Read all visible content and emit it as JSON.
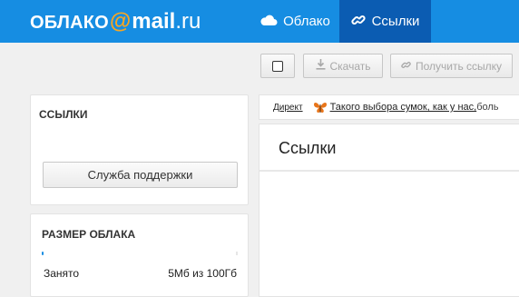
{
  "header": {
    "logo": {
      "part1": "ОБЛАКО",
      "at": "@",
      "part2": "mail",
      "part3": ".ru"
    },
    "nav": [
      {
        "label": "Облако",
        "icon": "cloud-icon",
        "active": false
      },
      {
        "label": "Ссылки",
        "icon": "link-icon",
        "active": true
      }
    ],
    "brand_color": "#168de2",
    "active_color": "#0b5cb2"
  },
  "toolbar": {
    "download_label": "Скачать",
    "get_link_label": "Получить ссылку"
  },
  "sidebar": {
    "links_panel": {
      "title": "ССЫЛКИ",
      "support_button": "Служба поддержки"
    },
    "size_panel": {
      "title": "РАЗМЕР ОБЛАКА",
      "used_label": "Занято",
      "used_value": "5Мб из 100Гб",
      "used_fraction": 5e-05
    }
  },
  "ad": {
    "label": "Директ",
    "icon": "butterfly-icon",
    "link_text": "Такого выбора сумок, как у нас,",
    "rest_text": " боль"
  },
  "main": {
    "title": "Ссылки"
  }
}
